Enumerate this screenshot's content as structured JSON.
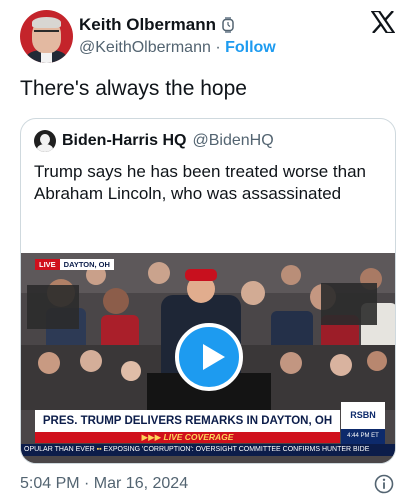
{
  "author": {
    "name": "Keith Olbermann",
    "badge_icon": "watch-icon",
    "handle": "@KeithOlbermann",
    "separator": "·",
    "follow_label": "Follow"
  },
  "platform_icon": "x-logo-icon",
  "tweet": {
    "text": "There's always the hope"
  },
  "quoted": {
    "name": "Biden-Harris HQ",
    "handle": "@BidenHQ",
    "text": "Trump says he has been treated worse than Abraham Lincoln, who was assassinated",
    "video": {
      "live_label": "LIVE",
      "location": "DAYTON, OH",
      "headline": "PRES. TRUMP DELIVERS REMARKS IN DAYTON, OH",
      "coverage_label": "LIVE COVERAGE",
      "network": "RSBN",
      "network_time": "4:44 PM ET",
      "ticker_left": "OPULAR THAN EVER",
      "ticker_right": "EXPOSING 'CORRUPTION': OVERSIGHT COMMITTEE CONFIRMS HUNTER BIDE",
      "play_icon": "play-icon"
    }
  },
  "meta": {
    "timestamp": "5:04 PM · Mar 16, 2024",
    "info_icon": "info-icon"
  },
  "colors": {
    "accent": "#1d9bf0",
    "text_secondary": "#536471",
    "live_red": "#d0101c",
    "news_navy": "#0c1d4a"
  }
}
